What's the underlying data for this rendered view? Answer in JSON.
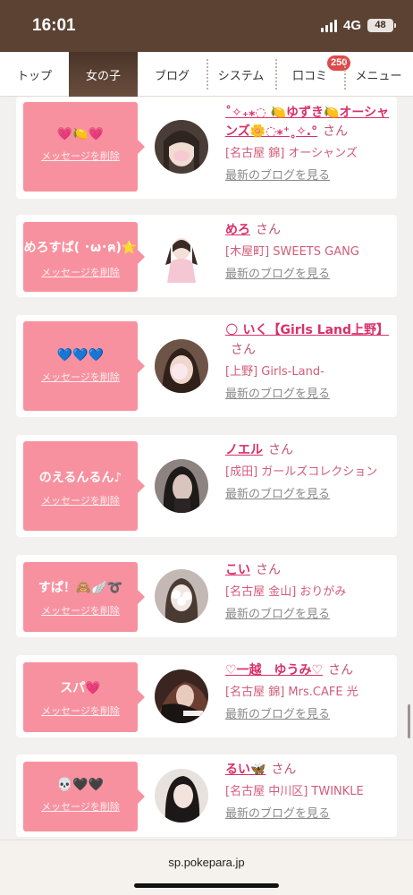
{
  "status": {
    "time": "16:01",
    "network": "4G",
    "battery": "48"
  },
  "nav": {
    "items": [
      {
        "label": "トップ"
      },
      {
        "label": "女の子",
        "active": true
      },
      {
        "label": "ブログ"
      },
      {
        "label": "システム"
      },
      {
        "label": "口コミ",
        "badge": "250"
      },
      {
        "label": "メニュー"
      }
    ]
  },
  "girls": [
    {
      "message": "💗🍋💗",
      "name": "˚✧₊⁎◌ 🍋ゆずき🍋オーシャンズ🌼◌⁎⁺˳✧.°",
      "honorific": "さん",
      "shop": "[名古屋 錦] オーシャンズ",
      "delete_label": "メッセージを削除",
      "blog_label": "最新のブログを見る"
    },
    {
      "message": "めろすぱ( ･ω･ฅ)⭐",
      "name": "めろ",
      "honorific": "さん",
      "shop": "[木屋町] SWEETS GANG",
      "delete_label": "メッセージを削除",
      "blog_label": "最新のブログを見る"
    },
    {
      "message": "💙💙💙",
      "name": "🌕 いく【Girls Land上野】",
      "honorific": "さん",
      "shop": "[上野] Girls-Land-",
      "delete_label": "メッセージを削除",
      "blog_label": "最新のブログを見る"
    },
    {
      "message": "のえるんるん♪",
      "name": "ノエル",
      "honorific": "さん",
      "shop": "[成田] ガールズコレクション",
      "delete_label": "メッセージを削除",
      "blog_label": "最新のブログを見る"
    },
    {
      "message": "すぱ！🙈🪽➰",
      "name": "こい",
      "honorific": "さん",
      "shop": "[名古屋 金山] おりがみ",
      "delete_label": "メッセージを削除",
      "blog_label": "最新のブログを見る"
    },
    {
      "message": "スパ💗",
      "name": "♡一越　ゆうみ♡",
      "honorific": "さん",
      "shop": "[名古屋 錦] Mrs.CAFE 光",
      "delete_label": "メッセージを削除",
      "blog_label": "最新のブログを見る"
    },
    {
      "message": "💀🖤🖤",
      "name": "るい🦋",
      "honorific": "さん",
      "shop": "[名古屋 中川区] TWINKLE",
      "delete_label": "メッセージを削除",
      "blog_label": "最新のブログを見る"
    }
  ],
  "url": "sp.pokepara.jp"
}
